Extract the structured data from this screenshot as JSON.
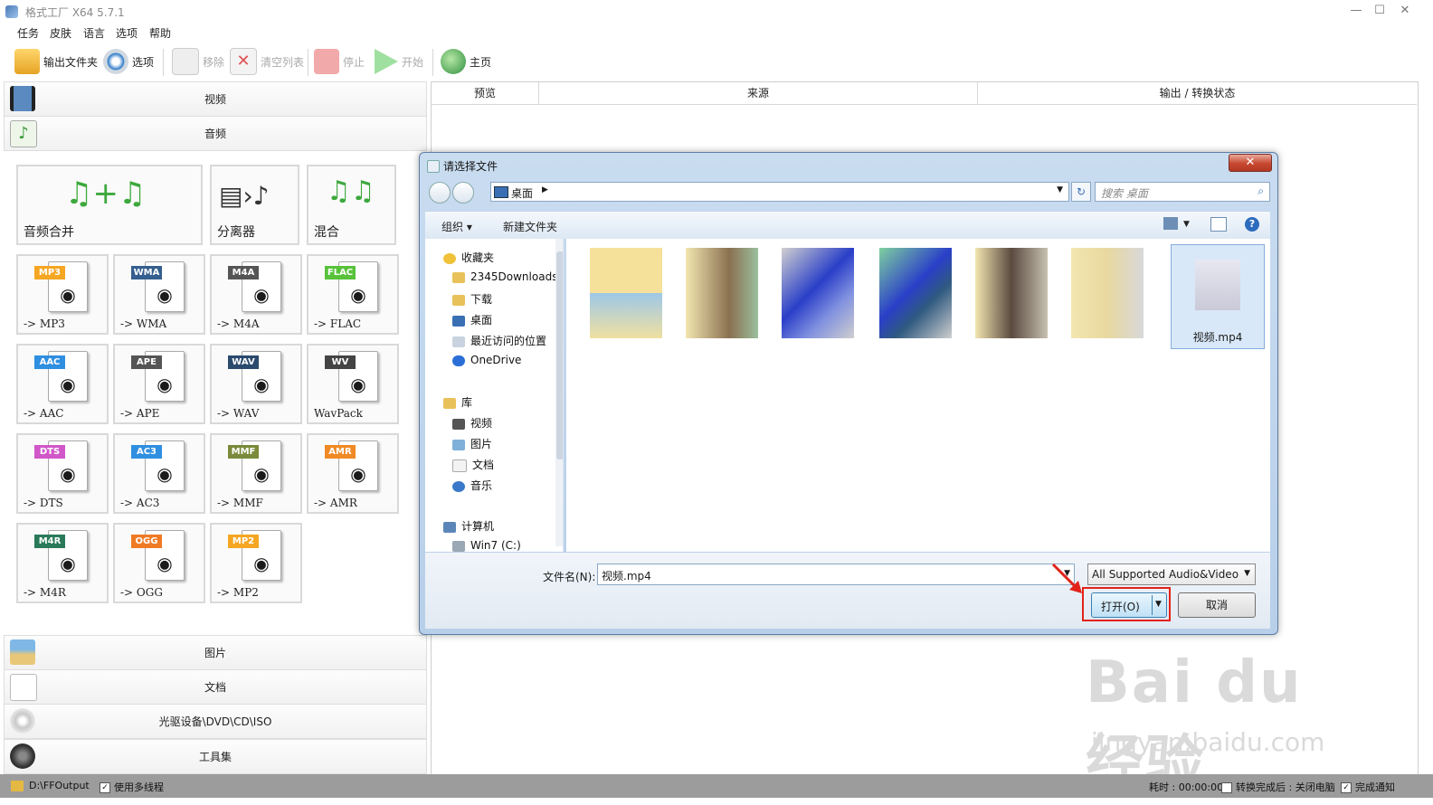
{
  "window": {
    "title": "格式工厂 X64 5.7.1",
    "controls": [
      "—",
      "☐",
      "✕"
    ]
  },
  "menu": [
    "任务",
    "皮肤",
    "语言",
    "选项",
    "帮助"
  ],
  "toolbar": {
    "output_folder": "输出文件夹",
    "options": "选项",
    "remove": "移除",
    "clear_list": "清空列表",
    "stop": "停止",
    "start": "开始",
    "home": "主页"
  },
  "categories": {
    "video": "视频",
    "audio": "音频",
    "image": "图片",
    "document": "文档",
    "optical": "光驱设备\\DVD\\CD\\ISO",
    "tools": "工具集"
  },
  "audio_tools": {
    "big": [
      "音频合并",
      "分离器",
      "混合"
    ],
    "formats": [
      {
        "badge": "MP3",
        "label": "-> MP3",
        "color": "#f5a623"
      },
      {
        "badge": "WMA",
        "label": "-> WMA",
        "color": "#355f8f"
      },
      {
        "badge": "M4A",
        "label": "-> M4A",
        "color": "#555555"
      },
      {
        "badge": "FLAC",
        "label": "-> FLAC",
        "color": "#58c23a"
      },
      {
        "badge": "AAC",
        "label": "-> AAC",
        "color": "#2f8fe0"
      },
      {
        "badge": "APE",
        "label": "-> APE",
        "color": "#555555"
      },
      {
        "badge": "WAV",
        "label": "-> WAV",
        "color": "#2a4a6e"
      },
      {
        "badge": "WV",
        "label": "WavPack",
        "color": "#444444"
      },
      {
        "badge": "DTS",
        "label": "-> DTS",
        "color": "#d157c9"
      },
      {
        "badge": "AC3",
        "label": "-> AC3",
        "color": "#2f8fe0"
      },
      {
        "badge": "MMF",
        "label": "-> MMF",
        "color": "#7a8a3a"
      },
      {
        "badge": "AMR",
        "label": "-> AMR",
        "color": "#f08a24"
      },
      {
        "badge": "M4R",
        "label": "-> M4R",
        "color": "#2a7a5a"
      },
      {
        "badge": "OGG",
        "label": "-> OGG",
        "color": "#f07a24"
      },
      {
        "badge": "MP2",
        "label": "-> MP2",
        "color": "#f5a623"
      }
    ]
  },
  "task_columns": [
    "预览",
    "来源",
    "输出 / 转换状态"
  ],
  "status": {
    "output_path": "D:\\FFOutput",
    "multithread": "使用多线程",
    "elapsed": "耗时 : 00:00:00",
    "after_done": "转换完成后 : 关闭电脑",
    "notify": "完成通知"
  },
  "dialog": {
    "title": "请选择文件",
    "close": "✕",
    "location": "桌面",
    "search_placeholder": "搜索 桌面",
    "organize": "组织",
    "new_folder": "新建文件夹",
    "nav": {
      "favorites": "收藏夹",
      "items": [
        "2345Downloads",
        "下载",
        "桌面",
        "最近访问的位置",
        "OneDrive"
      ],
      "library": "库",
      "lib_items": [
        "视频",
        "图片",
        "文档",
        "音乐"
      ],
      "computer": "计算机",
      "drives": [
        "Win7 (C:)"
      ]
    },
    "selected_file": "视频.mp4",
    "filename_label": "文件名(N):",
    "filename_value": "视频.mp4",
    "file_type": "All Supported Audio&Video",
    "open": "打开(O)",
    "cancel": "取消"
  },
  "watermark": {
    "brand": "Bai du 经验",
    "url": "jingyan.baidu.com"
  },
  "colors": {
    "accent": "#3c7fb1",
    "highlight": "#e2231a",
    "statusbar": "#9c9c9c"
  }
}
